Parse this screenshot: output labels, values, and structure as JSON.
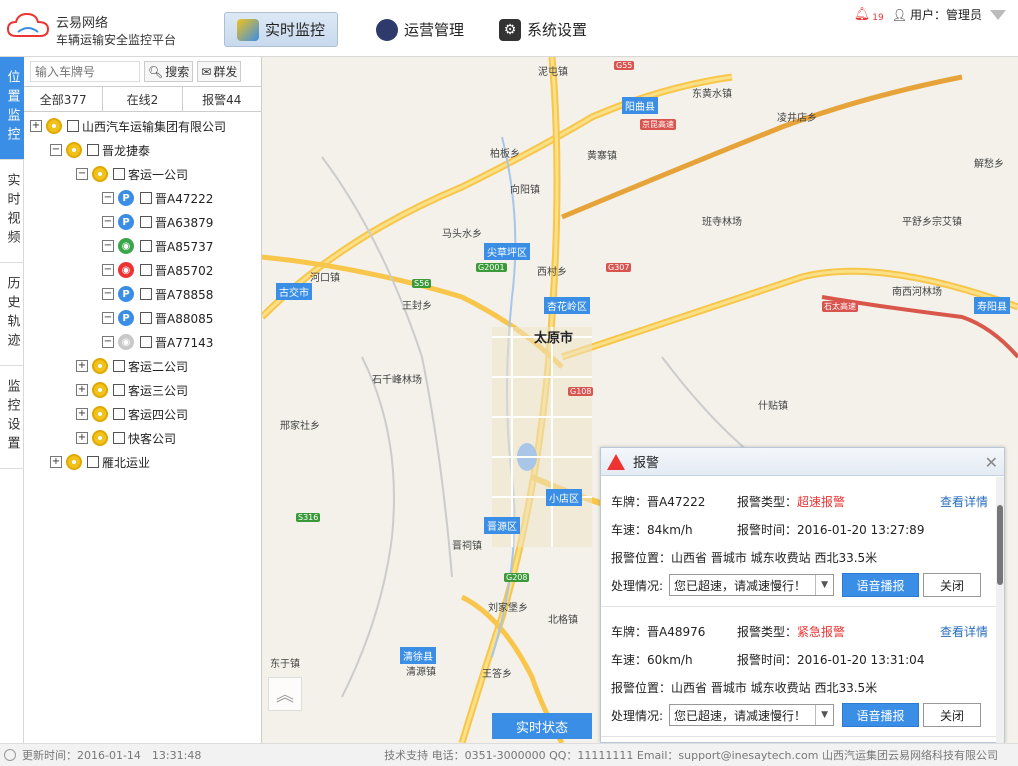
{
  "brand": {
    "name": "云易网络",
    "subtitle": "车辆运输安全监控平台"
  },
  "nav": [
    {
      "label": "实时监控",
      "icon": "map-icon",
      "active": true
    },
    {
      "label": "运营管理",
      "icon": "gauge-icon",
      "active": false
    },
    {
      "label": "系统设置",
      "icon": "gear-icon",
      "active": false
    }
  ],
  "user": {
    "alert_count": "19",
    "label": "用户：管理员"
  },
  "side_tabs": [
    "位置监控",
    "实时视频",
    "历史轨迹",
    "监控设置"
  ],
  "search": {
    "placeholder": "输入车牌号",
    "search_label": "搜索",
    "broadcast_label": "群发"
  },
  "tree_tabs": [
    "全部377",
    "在线2",
    "报警44"
  ],
  "tree": {
    "root": "山西汽车运输集团有限公司",
    "group1": "晋龙捷泰",
    "sub1": "客运一公司",
    "vehicles": [
      {
        "plate": "晋A47222",
        "status": "parked",
        "color": "#3a8ee6",
        "glyph": "P"
      },
      {
        "plate": "晋A63879",
        "status": "parked",
        "color": "#3a8ee6",
        "glyph": "P"
      },
      {
        "plate": "晋A85737",
        "status": "moving",
        "color": "#3aa54a",
        "glyph": "◉"
      },
      {
        "plate": "晋A85702",
        "status": "alarm",
        "color": "#e33",
        "glyph": "◉"
      },
      {
        "plate": "晋A78858",
        "status": "parked",
        "color": "#3a8ee6",
        "glyph": "P"
      },
      {
        "plate": "晋A88085",
        "status": "parked",
        "color": "#3a8ee6",
        "glyph": "P"
      },
      {
        "plate": "晋A77143",
        "status": "offline",
        "color": "#c8c8c8",
        "glyph": "◉"
      }
    ],
    "subs": [
      "客运二公司",
      "客运三公司",
      "客运四公司",
      "快客公司"
    ],
    "group2": "雁北运业"
  },
  "map": {
    "city": "太原市",
    "labels": [
      "泥屯镇",
      "东黄水镇",
      "阳曲县",
      "凌井店乡",
      "柏板乡",
      "黄寨镇",
      "向阳镇",
      "解愁乡",
      "马头水乡",
      "西村乡",
      "班寺林场",
      "平舒乡",
      "宗艾镇",
      "尖草坪区",
      "河口镇",
      "古交市",
      "王封乡",
      "杏花岭区",
      "南西河林场",
      "寿阳县",
      "石千峰林场",
      "什贴镇",
      "邢家社乡",
      "小店区",
      "晋源区",
      "晋祠镇",
      "刘家堡乡",
      "北格镇",
      "东于镇",
      "清徐县",
      "王答乡",
      "清源镇"
    ],
    "blue_areas": [
      "阳曲县",
      "尖草坪区",
      "古交市",
      "杏花岭区",
      "寿阳县",
      "小店区",
      "晋源区",
      "清徐县"
    ],
    "roads": [
      "G55",
      "G208",
      "G307",
      "G2001",
      "S56",
      "S316",
      "G108",
      "京昆高速",
      "石太高速"
    ],
    "status_button": "实时状态"
  },
  "alarm": {
    "title": "报警",
    "records": [
      {
        "plate_label": "车牌：晋A47222",
        "type_label": "报警类型：",
        "type_value": "超速报警",
        "detail_link": "查看详情",
        "speed_label": "车速：84km/h",
        "time_label": "报警时间：2016-01-20 13:27:89",
        "location_label": "报警位置：山西省 晋城市 城东收费站 西北33.5米",
        "handling_label": "处理情况:",
        "handling_value": "您已超速，请减速慢行！",
        "voice_button": "语音播报",
        "close_button": "关闭"
      },
      {
        "plate_label": "车牌：晋A48976",
        "type_label": "报警类型：",
        "type_value": "紧急报警",
        "detail_link": "查看详情",
        "speed_label": "车速：60km/h",
        "time_label": "报警时间：2016-01-20 13:31:04",
        "location_label": "报警位置：山西省 晋城市 城东收费站 西北33.5米",
        "handling_label": "处理情况:",
        "handling_value": "您已超速，请减速慢行！",
        "voice_button": "语音播报",
        "close_button": "关闭"
      }
    ]
  },
  "footer": {
    "updated": "更新时间：2016-01-14　13:31:48",
    "support": "技术支持 电话：0351-3000000 QQ：11111111 Email：support@inesaytech.com 山西汽运集团云易网络科技有限公司"
  }
}
